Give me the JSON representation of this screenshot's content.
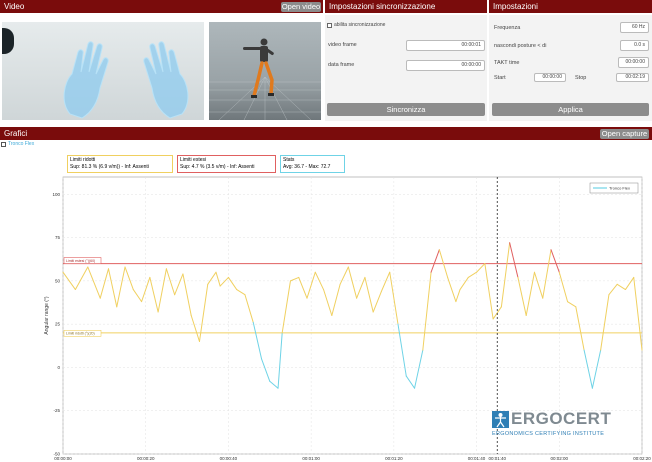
{
  "video": {
    "title": "Video",
    "open_label": "Open video"
  },
  "sync": {
    "title": "Impostazioni sincronizzazione",
    "enable_label": "abilita sincronizzazione",
    "video_frame_label": "video frame",
    "video_frame_value": "00:00:01",
    "data_frame_label": "data frame",
    "data_frame_value": "00:00:00",
    "button_label": "Sincronizza"
  },
  "settings": {
    "title": "Impostazioni",
    "freq_label": "Frequenza",
    "freq_value": "60 Hz",
    "hide_label": "nascondi posture < di",
    "hide_value": "0.0 s",
    "takt_label": "TAKT time",
    "takt_value": "00:00:00",
    "start_label": "Start",
    "start_value": "00:00:00",
    "stop_label": "Stop",
    "stop_value": "00:02:19",
    "apply_label": "Applica"
  },
  "charts": {
    "title": "Grafici",
    "open_label": "Open capture",
    "checkbox_label": "Tronco Flex"
  },
  "boxes": {
    "reduced": {
      "title": "Limiti ridotti",
      "text": "Sup: 81.3 % (6.9 v/m)) - Inf: Assenti"
    },
    "extended": {
      "title": "Limiti estesi",
      "text": "Sup: 4.7 % (3.5 v/m) - Inf: Assenti"
    },
    "stats": {
      "title": "Stats",
      "text": "Avg: 36.7 - Max: 72.7"
    }
  },
  "logo": {
    "name": "ERGOCERT",
    "tagline": "ERGONOMICS CERTIFYING INSTITUTE"
  },
  "colors": {
    "header": "#7a0c0c",
    "reduced": "#f0d060",
    "extended": "#e06060",
    "stats": "#6fd3e6"
  },
  "chart_data": {
    "type": "line",
    "ylabel": "Angular range (°)",
    "ylim": [
      -50,
      110
    ],
    "yticks": [
      "100",
      "75",
      "50",
      "25",
      "0",
      "-25",
      "-50"
    ],
    "xticks": [
      "00:00:00",
      "00:00:20",
      "00:00:40",
      "00:01:00",
      "00:01:20",
      "00:01:40",
      "00:02:00",
      "00:02:20"
    ],
    "legend": "Tronco Flex",
    "limit_extended": 60,
    "limit_reduced": 20,
    "limit_extended_label": "Limiti estesi (°)(60)",
    "limit_reduced_label": "Limiti ridotti (°)(20)",
    "cursor_label": "00:01:40",
    "cursor_time": 105,
    "x_max": 140,
    "series": [
      {
        "x": [
          0,
          3,
          6,
          9,
          11,
          13,
          15,
          17,
          19,
          21,
          23,
          25,
          27,
          29,
          31,
          33,
          35,
          37,
          38,
          40,
          42,
          44,
          46,
          48,
          50,
          52,
          53,
          55,
          57,
          59,
          61,
          63,
          65,
          67,
          69,
          71,
          73,
          75,
          77,
          79,
          81,
          83,
          85,
          87,
          89,
          91,
          93,
          95,
          96,
          98,
          100,
          102,
          104,
          106,
          108,
          110,
          112,
          114,
          116,
          118,
          120,
          122,
          124,
          126,
          128,
          130,
          132,
          134,
          136,
          138,
          140
        ],
        "y": [
          55,
          45,
          58,
          40,
          57,
          35,
          58,
          45,
          38,
          52,
          32,
          57,
          42,
          54,
          30,
          15,
          48,
          55,
          47,
          52,
          45,
          42,
          26,
          5,
          -8,
          -12,
          20,
          50,
          52,
          40,
          55,
          45,
          30,
          48,
          58,
          40,
          52,
          32,
          44,
          55,
          25,
          -5,
          -12,
          10,
          55,
          68,
          52,
          38,
          45,
          52,
          55,
          60,
          28,
          35,
          72,
          52,
          30,
          55,
          40,
          68,
          55,
          38,
          35,
          10,
          -12,
          10,
          42,
          48,
          45,
          52,
          10
        ]
      }
    ]
  }
}
